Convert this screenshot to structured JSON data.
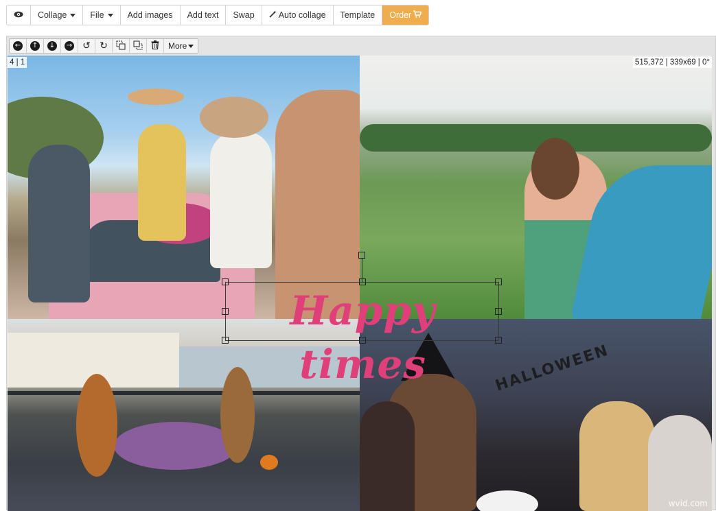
{
  "toolbar": {
    "preview_icon": "eye-icon",
    "collage": "Collage",
    "file": "File",
    "add_images": "Add images",
    "add_text": "Add text",
    "swap": "Swap",
    "auto_collage": "Auto collage",
    "auto_collage_icon": "magic-wand-icon",
    "template": "Template",
    "order": "Order",
    "order_icon": "cart-icon",
    "order_color": "#f0ad4e"
  },
  "edit_toolbar": {
    "buttons": [
      "arrow-left-icon",
      "arrow-up-icon",
      "arrow-down-icon",
      "arrow-right-icon",
      "rotate-left-icon",
      "rotate-right-icon",
      "bring-forward-icon",
      "send-backward-icon",
      "trash-icon"
    ],
    "more": "More"
  },
  "canvas": {
    "cell_index": "4 | 1",
    "status": "515,372 | 339x69 | 0°",
    "text_element": "Happy times",
    "text_color": "#e0407a",
    "cells": [
      "photo-friends-car",
      "photo-woman-field",
      "photo-halloween-table",
      "photo-halloween-party"
    ],
    "sign_text": "HALLOWEEN",
    "watermark": "wvid.com"
  }
}
